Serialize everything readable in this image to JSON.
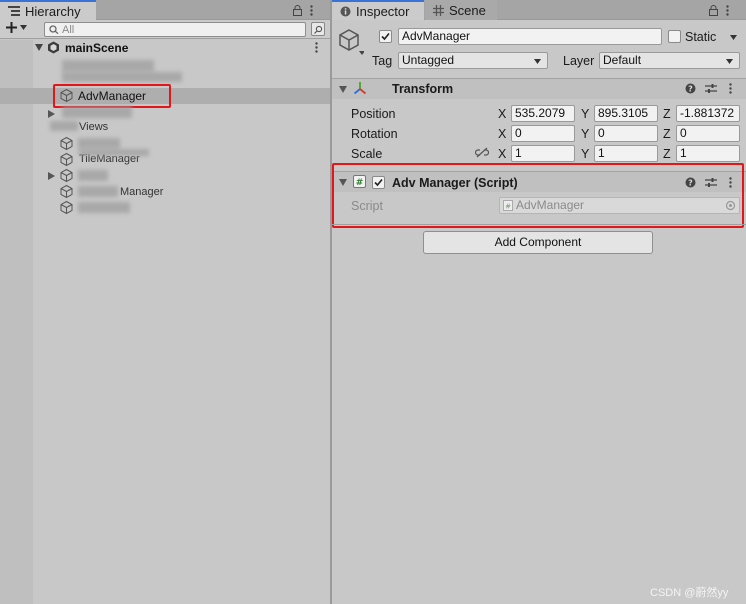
{
  "hierarchy": {
    "tab_label": "Hierarchy",
    "search_placeholder": "All",
    "scene_name": "mainScene",
    "selected_object": "AdvManager",
    "partial_rows": [
      "Views",
      "TileManager",
      "Manager"
    ]
  },
  "inspector": {
    "tab_label": "Inspector",
    "scene_tab_label": "Scene",
    "object_name": "AdvManager",
    "static_label": "Static",
    "tag_label": "Tag",
    "tag_value": "Untagged",
    "layer_label": "Layer",
    "layer_value": "Default",
    "transform": {
      "title": "Transform",
      "position_label": "Position",
      "rotation_label": "Rotation",
      "scale_label": "Scale",
      "axis_x": "X",
      "axis_y": "Y",
      "axis_z": "Z",
      "position": {
        "x": "535.2079",
        "y": "895.3105",
        "z": "-1.881372"
      },
      "rotation": {
        "x": "0",
        "y": "0",
        "z": "0"
      },
      "scale": {
        "x": "1",
        "y": "1",
        "z": "1"
      }
    },
    "script_component": {
      "title": "Adv Manager (Script)",
      "script_label": "Script",
      "script_value": "AdvManager"
    },
    "add_component_label": "Add Component"
  },
  "watermark": "CSDN @蔚然yy",
  "colors": {
    "highlight_red": "#e3161a",
    "tab_accent": "#3a72d6"
  }
}
